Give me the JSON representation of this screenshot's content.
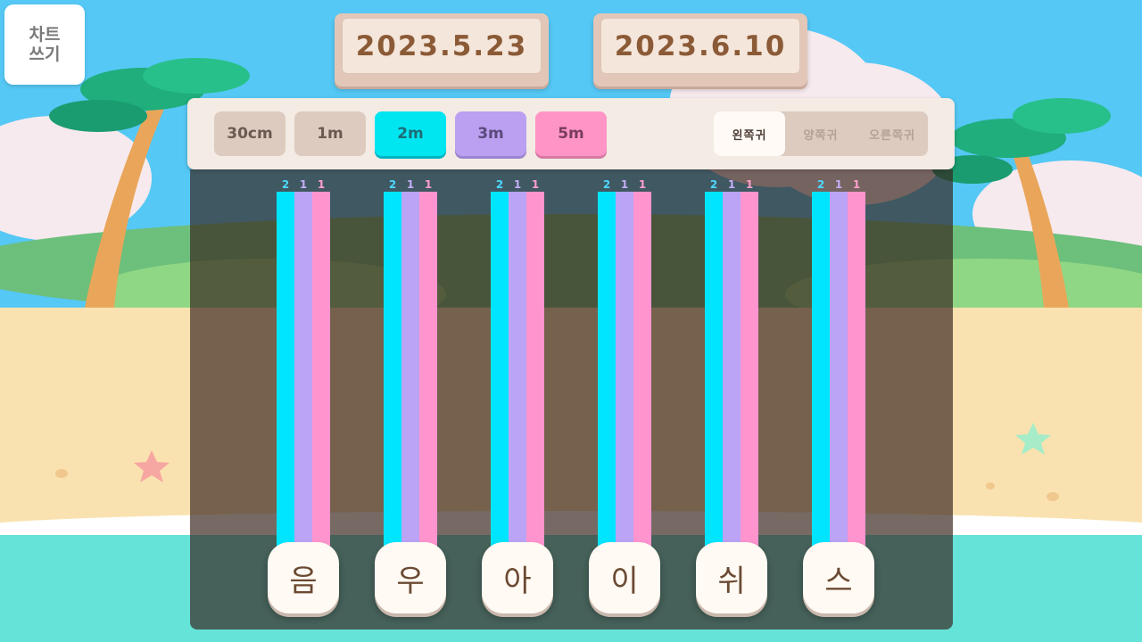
{
  "header": {
    "write_chart_label_line1": "차트",
    "write_chart_label_line2": "쓰기",
    "date_start": "2023.5.23",
    "date_end": "2023.6.10"
  },
  "distance_buttons": [
    {
      "label": "30cm",
      "color": "#ddcbc0"
    },
    {
      "label": "1m",
      "color": "#ddcbc0"
    },
    {
      "label": "2m",
      "color": "#00e6f0"
    },
    {
      "label": "3m",
      "color": "#bb9ff0"
    },
    {
      "label": "5m",
      "color": "#ff94c6"
    }
  ],
  "ear_options": {
    "left": "왼쪽귀",
    "both": "양쪽귀",
    "right": "오른쪽귀",
    "selected": "left"
  },
  "chart_data": {
    "type": "bar",
    "categories": [
      "음",
      "우",
      "아",
      "이",
      "쉬",
      "스"
    ],
    "series": [
      {
        "name": "2m",
        "color": "#00e5ff",
        "values": [
          2,
          2,
          2,
          2,
          2,
          2
        ]
      },
      {
        "name": "3m",
        "color": "#bba3f5",
        "values": [
          1,
          1,
          1,
          1,
          1,
          1
        ]
      },
      {
        "name": "5m",
        "color": "#ff94cf",
        "values": [
          1,
          1,
          1,
          1,
          1,
          1
        ]
      }
    ],
    "grid": false,
    "legend": "none"
  }
}
